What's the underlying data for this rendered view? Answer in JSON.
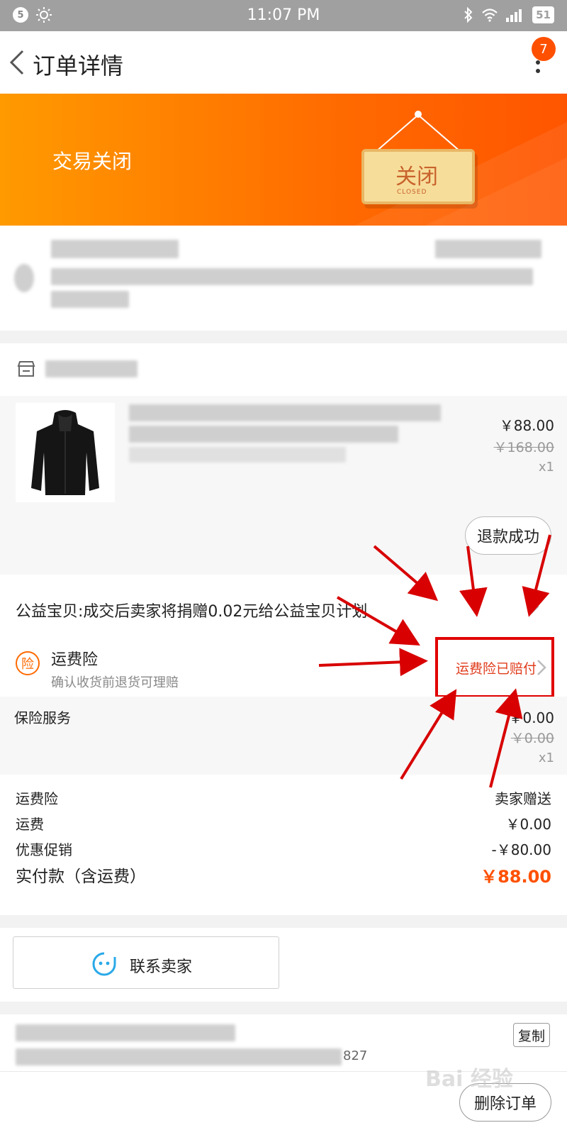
{
  "status_bar": {
    "notification_count": "5",
    "time": "11:07 PM",
    "battery": "51"
  },
  "nav": {
    "title": "订单详情",
    "more_badge": "7"
  },
  "banner": {
    "status": "交易关闭",
    "sign_cn": "关闭",
    "sign_en": "CLOSED"
  },
  "product": {
    "price": "￥88.00",
    "original_price": "￥168.00",
    "quantity": "x1",
    "refund_status": "退款成功"
  },
  "charity": {
    "text": "公益宝贝:成交后卖家将捐赠0.02元给公益宝贝计划"
  },
  "insurance": {
    "icon_char": "险",
    "title": "运费险",
    "subtitle": "确认收货前退货可理赔",
    "status": "运费险已赔付"
  },
  "service": {
    "title": "保险服务",
    "price": "￥0.00",
    "original_price": "￥0.00",
    "quantity": "x1"
  },
  "summary": {
    "rows": [
      {
        "label": "运费险",
        "value": "卖家赠送"
      },
      {
        "label": "运费",
        "value": "￥0.00"
      },
      {
        "label": "优惠促销",
        "value": "-￥80.00"
      }
    ],
    "total_label": "实付款（含运费）",
    "total_value": "￥88.00"
  },
  "contact": {
    "label": "联系卖家"
  },
  "order": {
    "copy_label": "复制",
    "number_tail": "827"
  },
  "bottom": {
    "delete_label": "删除订单"
  },
  "watermark": {
    "text": "Bai 经验"
  },
  "colors": {
    "accent": "#ff5000",
    "highlight": "#e00000",
    "banner_start": "#ff9a00",
    "banner_end": "#ff5500"
  }
}
